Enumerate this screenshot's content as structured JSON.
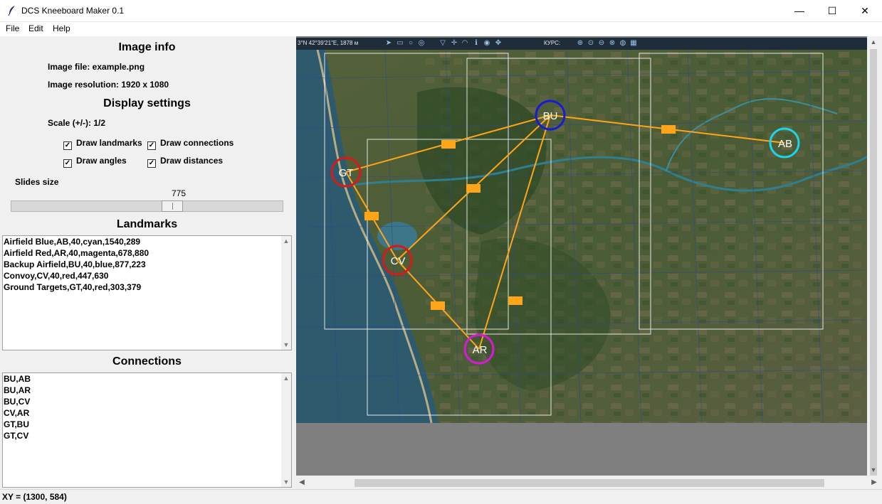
{
  "window": {
    "title": "DCS Kneeboard Maker 0.1",
    "title_icon": "feather-icon",
    "minimize_glyph": "—",
    "maximize_glyph": "☐",
    "close_glyph": "✕"
  },
  "menu": [
    "File",
    "Edit",
    "Help"
  ],
  "image_info": {
    "heading": "Image info",
    "file_line": "Image file: example.png",
    "resolution_line": "Image resolution: 1920 x 1080"
  },
  "display_settings": {
    "heading": "Display settings",
    "scale_line": "Scale (+/-): 1/2",
    "checkboxes": [
      {
        "label": "Draw landmarks",
        "checked": true
      },
      {
        "label": "Draw connections",
        "checked": true
      },
      {
        "label": "Draw angles",
        "checked": true
      },
      {
        "label": "Draw distances",
        "checked": true
      }
    ],
    "check_glyph": "✓"
  },
  "slides": {
    "label": "Slides size",
    "value": "775",
    "level": 0.6
  },
  "landmarks": {
    "heading": "Landmarks",
    "rows": [
      "Airfield Blue,AB,40,cyan,1540,289",
      "Airfield Red,AR,40,magenta,678,880",
      "Backup Airfield,BU,40,blue,877,223",
      "Convoy,CV,40,red,447,630",
      "Ground Targets,GT,40,red,303,379"
    ]
  },
  "connections": {
    "heading": "Connections",
    "rows": [
      "BU,AB",
      "BU,AR",
      "BU,CV",
      "CV,AR",
      "GT,BU",
      "GT,CV"
    ]
  },
  "map": {
    "toolbar_coords": "3°N 42°39'21\"E, 1878 м",
    "toolbar_course": "КУРС:",
    "markers": [
      {
        "label": "AB",
        "color": "#1ad6e8"
      },
      {
        "label": "AR",
        "color": "#d61ad6"
      },
      {
        "label": "BU",
        "color": "#1a1ad6"
      },
      {
        "label": "CV",
        "color": "#d61a1a"
      },
      {
        "label": "GT",
        "color": "#d61a1a"
      }
    ],
    "connection_color": "#ffa51a",
    "slide_frame_color": "#ffffff"
  },
  "status": {
    "text": "XY = (1300, 584)"
  },
  "scroll_glyphs": {
    "up": "▲",
    "down": "▼",
    "left": "◀",
    "right": "▶"
  }
}
